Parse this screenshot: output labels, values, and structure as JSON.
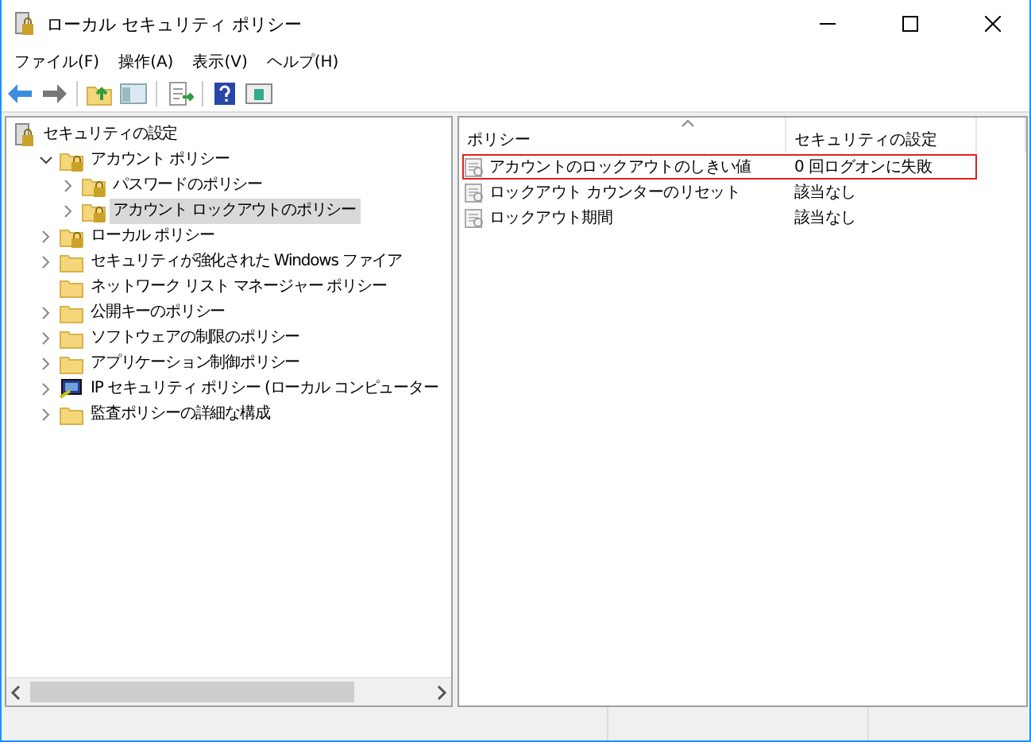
{
  "window": {
    "title": "ローカル セキュリティ ポリシー"
  },
  "menu": [
    "ファイル(F)",
    "操作(A)",
    "表示(V)",
    "ヘルプ(H)"
  ],
  "tree": [
    {
      "label": "セキュリティの設定",
      "kind": "root",
      "selected": false,
      "children": [
        {
          "label": "アカウント ポリシー",
          "kind": "locked-folder",
          "expandable": true,
          "expanded": true,
          "selected": false,
          "children": [
            {
              "label": "パスワードのポリシー",
              "kind": "locked-folder",
              "expandable": true,
              "expanded": false,
              "selected": false
            },
            {
              "label": "アカウント ロックアウトのポリシー",
              "kind": "locked-folder",
              "expandable": true,
              "expanded": false,
              "selected": true
            }
          ]
        },
        {
          "label": "ローカル ポリシー",
          "kind": "locked-folder",
          "expandable": true,
          "expanded": false,
          "selected": false
        },
        {
          "label": "セキュリティが強化された Windows ファイア",
          "kind": "folder",
          "expandable": true,
          "expanded": false,
          "selected": false
        },
        {
          "label": "ネットワーク リスト マネージャー ポリシー",
          "kind": "folder",
          "expandable": false,
          "expanded": false,
          "selected": false
        },
        {
          "label": "公開キーのポリシー",
          "kind": "folder",
          "expandable": true,
          "expanded": false,
          "selected": false
        },
        {
          "label": "ソフトウェアの制限のポリシー",
          "kind": "folder",
          "expandable": true,
          "expanded": false,
          "selected": false
        },
        {
          "label": "アプリケーション制御ポリシー",
          "kind": "folder",
          "expandable": true,
          "expanded": false,
          "selected": false
        },
        {
          "label": "IP セキュリティ ポリシー (ローカル コンピューター",
          "kind": "computer",
          "expandable": true,
          "expanded": false,
          "selected": false
        },
        {
          "label": "監査ポリシーの詳細な構成",
          "kind": "folder",
          "expandable": true,
          "expanded": false,
          "selected": false
        }
      ]
    }
  ],
  "list": {
    "columns": [
      "ポリシー",
      "セキュリティの設定"
    ],
    "rows": [
      {
        "policy": "アカウントのロックアウトのしきい値",
        "setting": "0 回ログオンに失敗",
        "highlighted": true
      },
      {
        "policy": "ロックアウト カウンターのリセット",
        "setting": "該当なし",
        "highlighted": false
      },
      {
        "policy": "ロックアウト期間",
        "setting": "該当なし",
        "highlighted": false
      }
    ]
  }
}
